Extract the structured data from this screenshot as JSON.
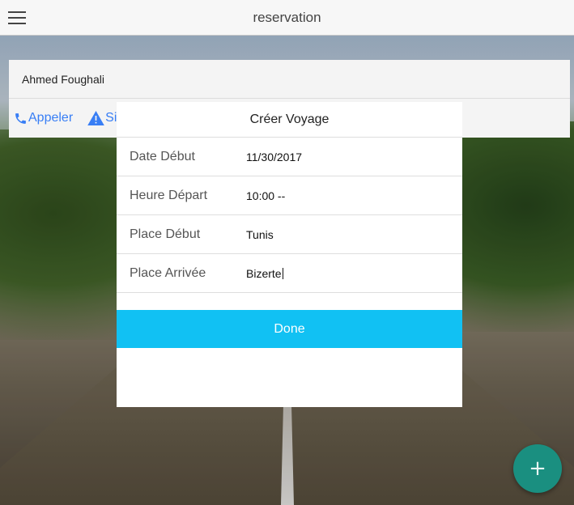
{
  "header": {
    "title": "reservation",
    "menu_icon": "hamburger-menu-icon"
  },
  "card": {
    "name": "Ahmed Foughali",
    "actions": [
      {
        "label": "Appeler",
        "icon": "phone-icon"
      },
      {
        "label": "Si",
        "icon": "warning-icon"
      }
    ]
  },
  "modal": {
    "title": "Créer Voyage",
    "fields": [
      {
        "label": "Date Début",
        "value": "11/30/2017"
      },
      {
        "label": "Heure Départ",
        "value": "10:00 --"
      },
      {
        "label": "Place Début",
        "value": "Tunis"
      },
      {
        "label": "Place Arrivée",
        "value": "Bizerte"
      }
    ],
    "done_label": "Done"
  },
  "fab": {
    "label": "+",
    "icon": "add-icon"
  },
  "colors": {
    "accent": "#11c1f3",
    "link": "#387ef5",
    "fab": "#1a8f80"
  }
}
